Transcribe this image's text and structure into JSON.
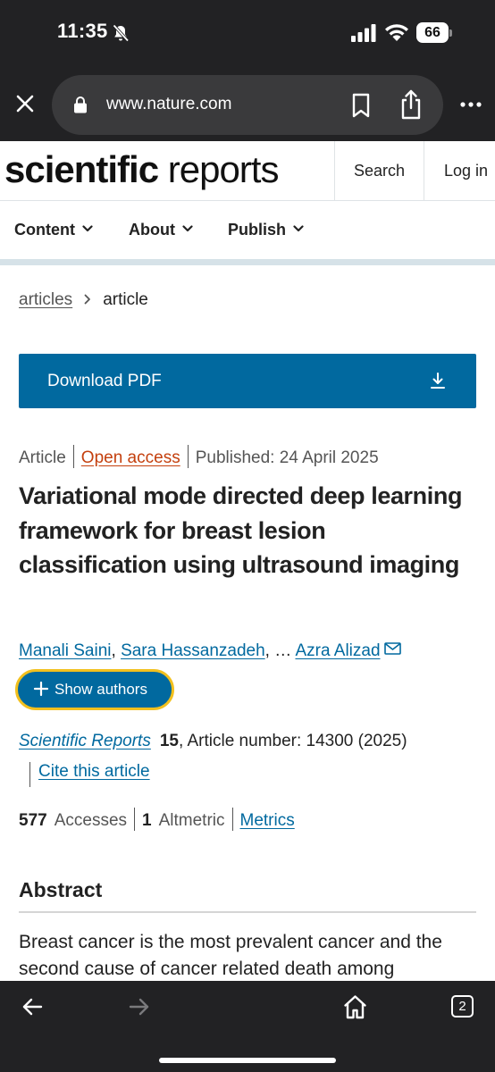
{
  "status_bar": {
    "time": "11:35",
    "battery_level": "66",
    "icons": [
      "bell-off-icon",
      "signal-icon",
      "wifi-icon",
      "battery-icon"
    ]
  },
  "browser": {
    "url": "www.nature.com",
    "tab_count": "2",
    "icons": [
      "close-icon",
      "lock-icon",
      "bookmark-icon",
      "share-icon",
      "more-icon",
      "back-icon",
      "forward-icon",
      "home-icon"
    ]
  },
  "site": {
    "brand_bold": "scientific",
    "brand_light": " reports",
    "search_label": "Search",
    "login_label": "Log in",
    "nav": [
      {
        "label": "Content"
      },
      {
        "label": "About"
      },
      {
        "label": "Publish"
      }
    ]
  },
  "breadcrumb": {
    "parent": "articles",
    "current": "article"
  },
  "download": {
    "label": "Download PDF"
  },
  "article": {
    "type": "Article",
    "access": "Open access",
    "published": "Published: 24 April 2025",
    "title": "Variational mode directed deep learning framework for breast lesion classification using ultrasound imaging",
    "authors": [
      "Manali Saini",
      "Sara Hassanzadeh",
      "Azra Alizad"
    ],
    "authors_sep": ", ",
    "authors_ellipsis": ", … ",
    "show_authors_label": "Show authors",
    "journal": "Scientific Reports",
    "volume": "15",
    "article_number": ", Article number: 14300 (2025)",
    "cite_label": "Cite this article",
    "accesses_count": "577",
    "accesses_label": "Accesses",
    "altmetric_count": "1",
    "altmetric_label": "Altmetric",
    "metrics_label": "Metrics"
  },
  "abstract": {
    "heading": "Abstract",
    "text": "Breast cancer is the most prevalent cancer and the second cause of cancer related death among"
  },
  "colors": {
    "brand_blue": "#01699f",
    "open_access_orange": "#c4400e",
    "focus_ring": "#f2c01e",
    "chrome_dark": "#222224"
  }
}
